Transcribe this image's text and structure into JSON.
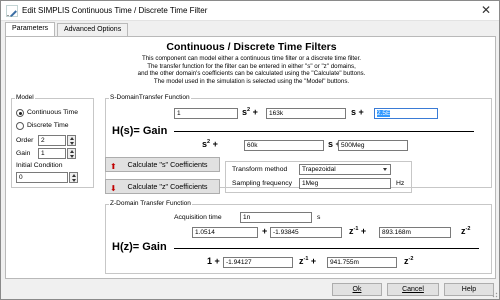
{
  "window": {
    "title": "Edit SIMPLIS Continuous Time / Discrete Time Filter",
    "close_glyph": "✕"
  },
  "tabs": [
    {
      "label": "Parameters"
    },
    {
      "label": "Advanced Options"
    }
  ],
  "heading": "Continuous / Discrete Time Filters",
  "description": [
    "This component can model either a continuous time filter or a discrete time filter.",
    "The transfer function for the filter can be entered in either \"s\" or \"z\" domains,",
    "and the other domain's coefficients can be calculated using the \"Calculate\" buttons.",
    "The model used in the simulation is selected using the \"Model\" buttons."
  ],
  "model": {
    "label": "Model",
    "continuous": "Continuous Time",
    "discrete": "Discrete Time",
    "selected": "Continuous Time",
    "order_label": "Order",
    "order_value": "2",
    "gain_label": "Gain",
    "gain_value": "1",
    "initial_label": "Initial Condition",
    "initial_value": "0"
  },
  "s_domain": {
    "label": "S-DomainTransfer Function",
    "gain_label": "H(s)= Gain",
    "num": [
      "1",
      "163k",
      "2.5E"
    ],
    "den": [
      "60k",
      "500Meg"
    ],
    "s2": "s",
    "s1": "s",
    "plus": "+",
    "den_s2": "s",
    "den_s1": "s"
  },
  "buttons": {
    "calc_s": "Calculate \"s\" Coefficients",
    "calc_z": "Calculate \"z\" Coefficients"
  },
  "transform": {
    "method_label": "Transform method",
    "method_value": "Trapezoidal",
    "freq_label": "Sampling frequency",
    "freq_value": "1Meg",
    "freq_unit": "Hz"
  },
  "z_domain": {
    "label": "Z-Domain Transfer Function",
    "acq_label": "Acquisition time",
    "acq_value": "1n",
    "acq_unit": "s",
    "gain_label": "H(z)= Gain",
    "num": [
      "1.0514",
      "-1.93845",
      "893.168m"
    ],
    "den": [
      "1",
      "-1.94127",
      "941.755m"
    ],
    "z": "z"
  },
  "footer": {
    "ok": "Ok",
    "cancel": "Cancel",
    "help": "Help"
  },
  "colors": {
    "accent": "#3399ff",
    "arrow": "#c00000"
  }
}
